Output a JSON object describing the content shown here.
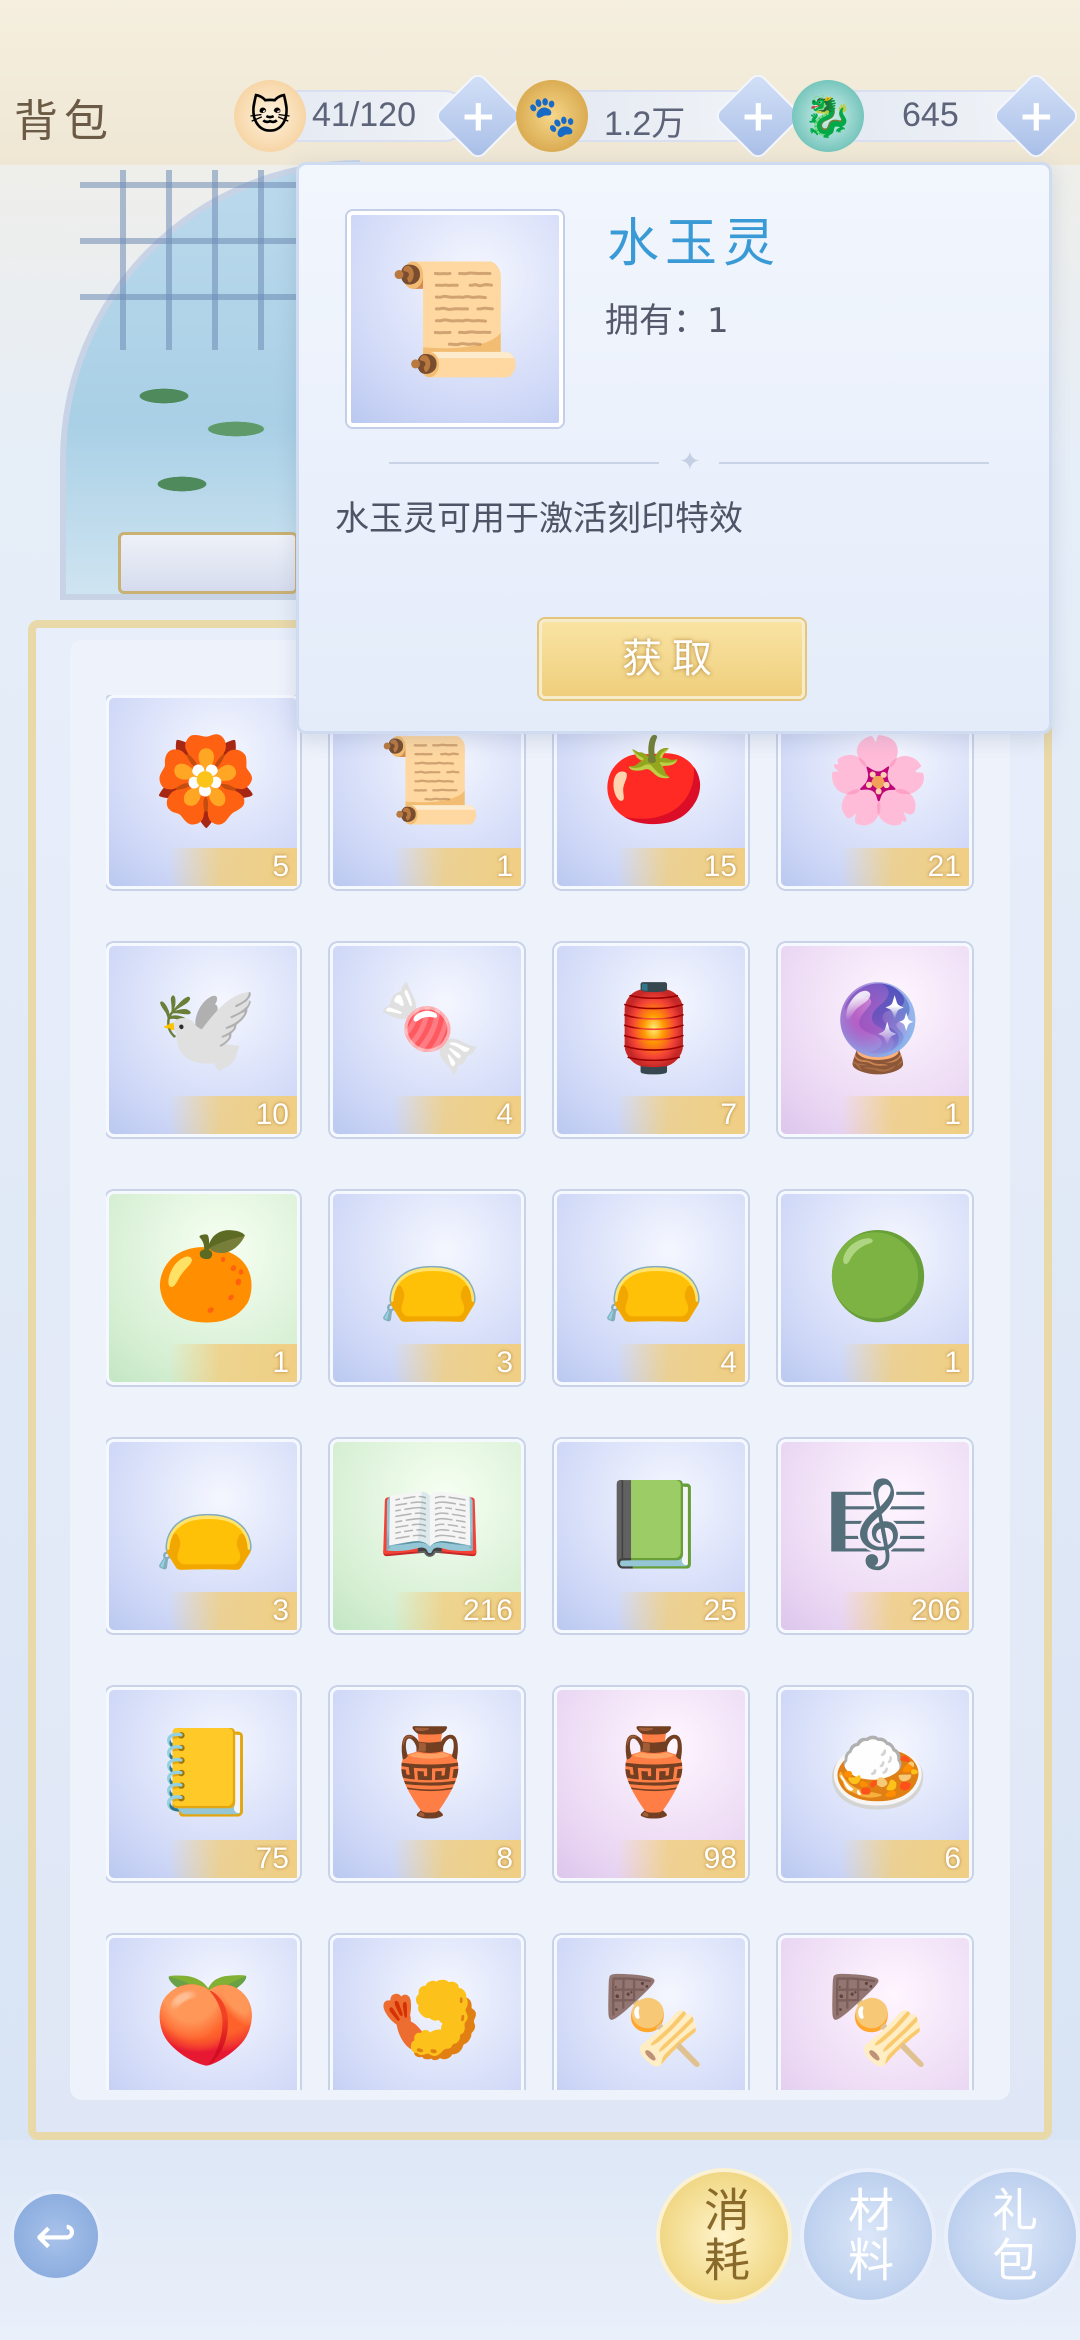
{
  "header": {
    "title": "背包",
    "resources": [
      {
        "icon": "cat-face-icon",
        "value": "41/120"
      },
      {
        "icon": "paw-coin-icon",
        "value": "1.2万"
      },
      {
        "icon": "jade-serpent-icon",
        "value": "645"
      }
    ],
    "plus_label": "+"
  },
  "popup": {
    "item_name": "水玉灵",
    "owned_text": "拥有：1",
    "description": "水玉灵可用于激活刻印特效",
    "acquire_label": "获取"
  },
  "items": [
    {
      "icon": "jade-rose-icon",
      "count": "5",
      "bg": "blue"
    },
    {
      "icon": "water-jade-scroll-icon",
      "count": "1",
      "bg": "blue"
    },
    {
      "icon": "persimmon-icon",
      "count": "15",
      "bg": "blue"
    },
    {
      "icon": "peach-blossom-icon",
      "count": "21",
      "bg": "blue"
    },
    {
      "icon": "paper-crane-icon",
      "count": "10",
      "bg": "blue"
    },
    {
      "icon": "candy-box-icon",
      "count": "4",
      "bg": "blue"
    },
    {
      "icon": "lotus-lantern-icon",
      "count": "7",
      "bg": "blue"
    },
    {
      "icon": "crystal-ball-icon",
      "count": "1",
      "bg": "purple"
    },
    {
      "icon": "orange-bundle-icon",
      "count": "1",
      "bg": "green"
    },
    {
      "icon": "pouch-orange-icon",
      "count": "3",
      "bg": "blue"
    },
    {
      "icon": "pouch-green-icon",
      "count": "4",
      "bg": "blue"
    },
    {
      "icon": "green-pearl-icon",
      "count": "1",
      "bg": "blue"
    },
    {
      "icon": "pouch-red-icon",
      "count": "3",
      "bg": "blue"
    },
    {
      "icon": "music-book-icon",
      "count": "216",
      "bg": "green"
    },
    {
      "icon": "music-book-heart-icon",
      "count": "25",
      "bg": "blue"
    },
    {
      "icon": "music-score-set-icon",
      "count": "206",
      "bg": "purple"
    },
    {
      "icon": "golden-score-icon",
      "count": "75",
      "bg": "blue"
    },
    {
      "icon": "wine-jar-icon",
      "count": "8",
      "bg": "blue"
    },
    {
      "icon": "wine-jars-icon",
      "count": "98",
      "bg": "purple"
    },
    {
      "icon": "dish-meatball-icon",
      "count": "6",
      "bg": "blue"
    },
    {
      "icon": "apricot-plate-icon",
      "count": "",
      "bg": "blue"
    },
    {
      "icon": "shrimp-plate-icon",
      "count": "",
      "bg": "blue"
    },
    {
      "icon": "skewer-plate-icon",
      "count": "",
      "bg": "blue"
    },
    {
      "icon": "skewer-platter-icon",
      "count": "",
      "bg": "purple"
    }
  ],
  "tabs": [
    {
      "label": "消耗",
      "active": true
    },
    {
      "label": "材料",
      "active": false
    },
    {
      "label": "礼包",
      "active": false
    }
  ],
  "back_icon": "back-arrow-icon",
  "colors": {
    "accent_gold": "#efcf7d",
    "title_blue": "#3a9ad6"
  }
}
